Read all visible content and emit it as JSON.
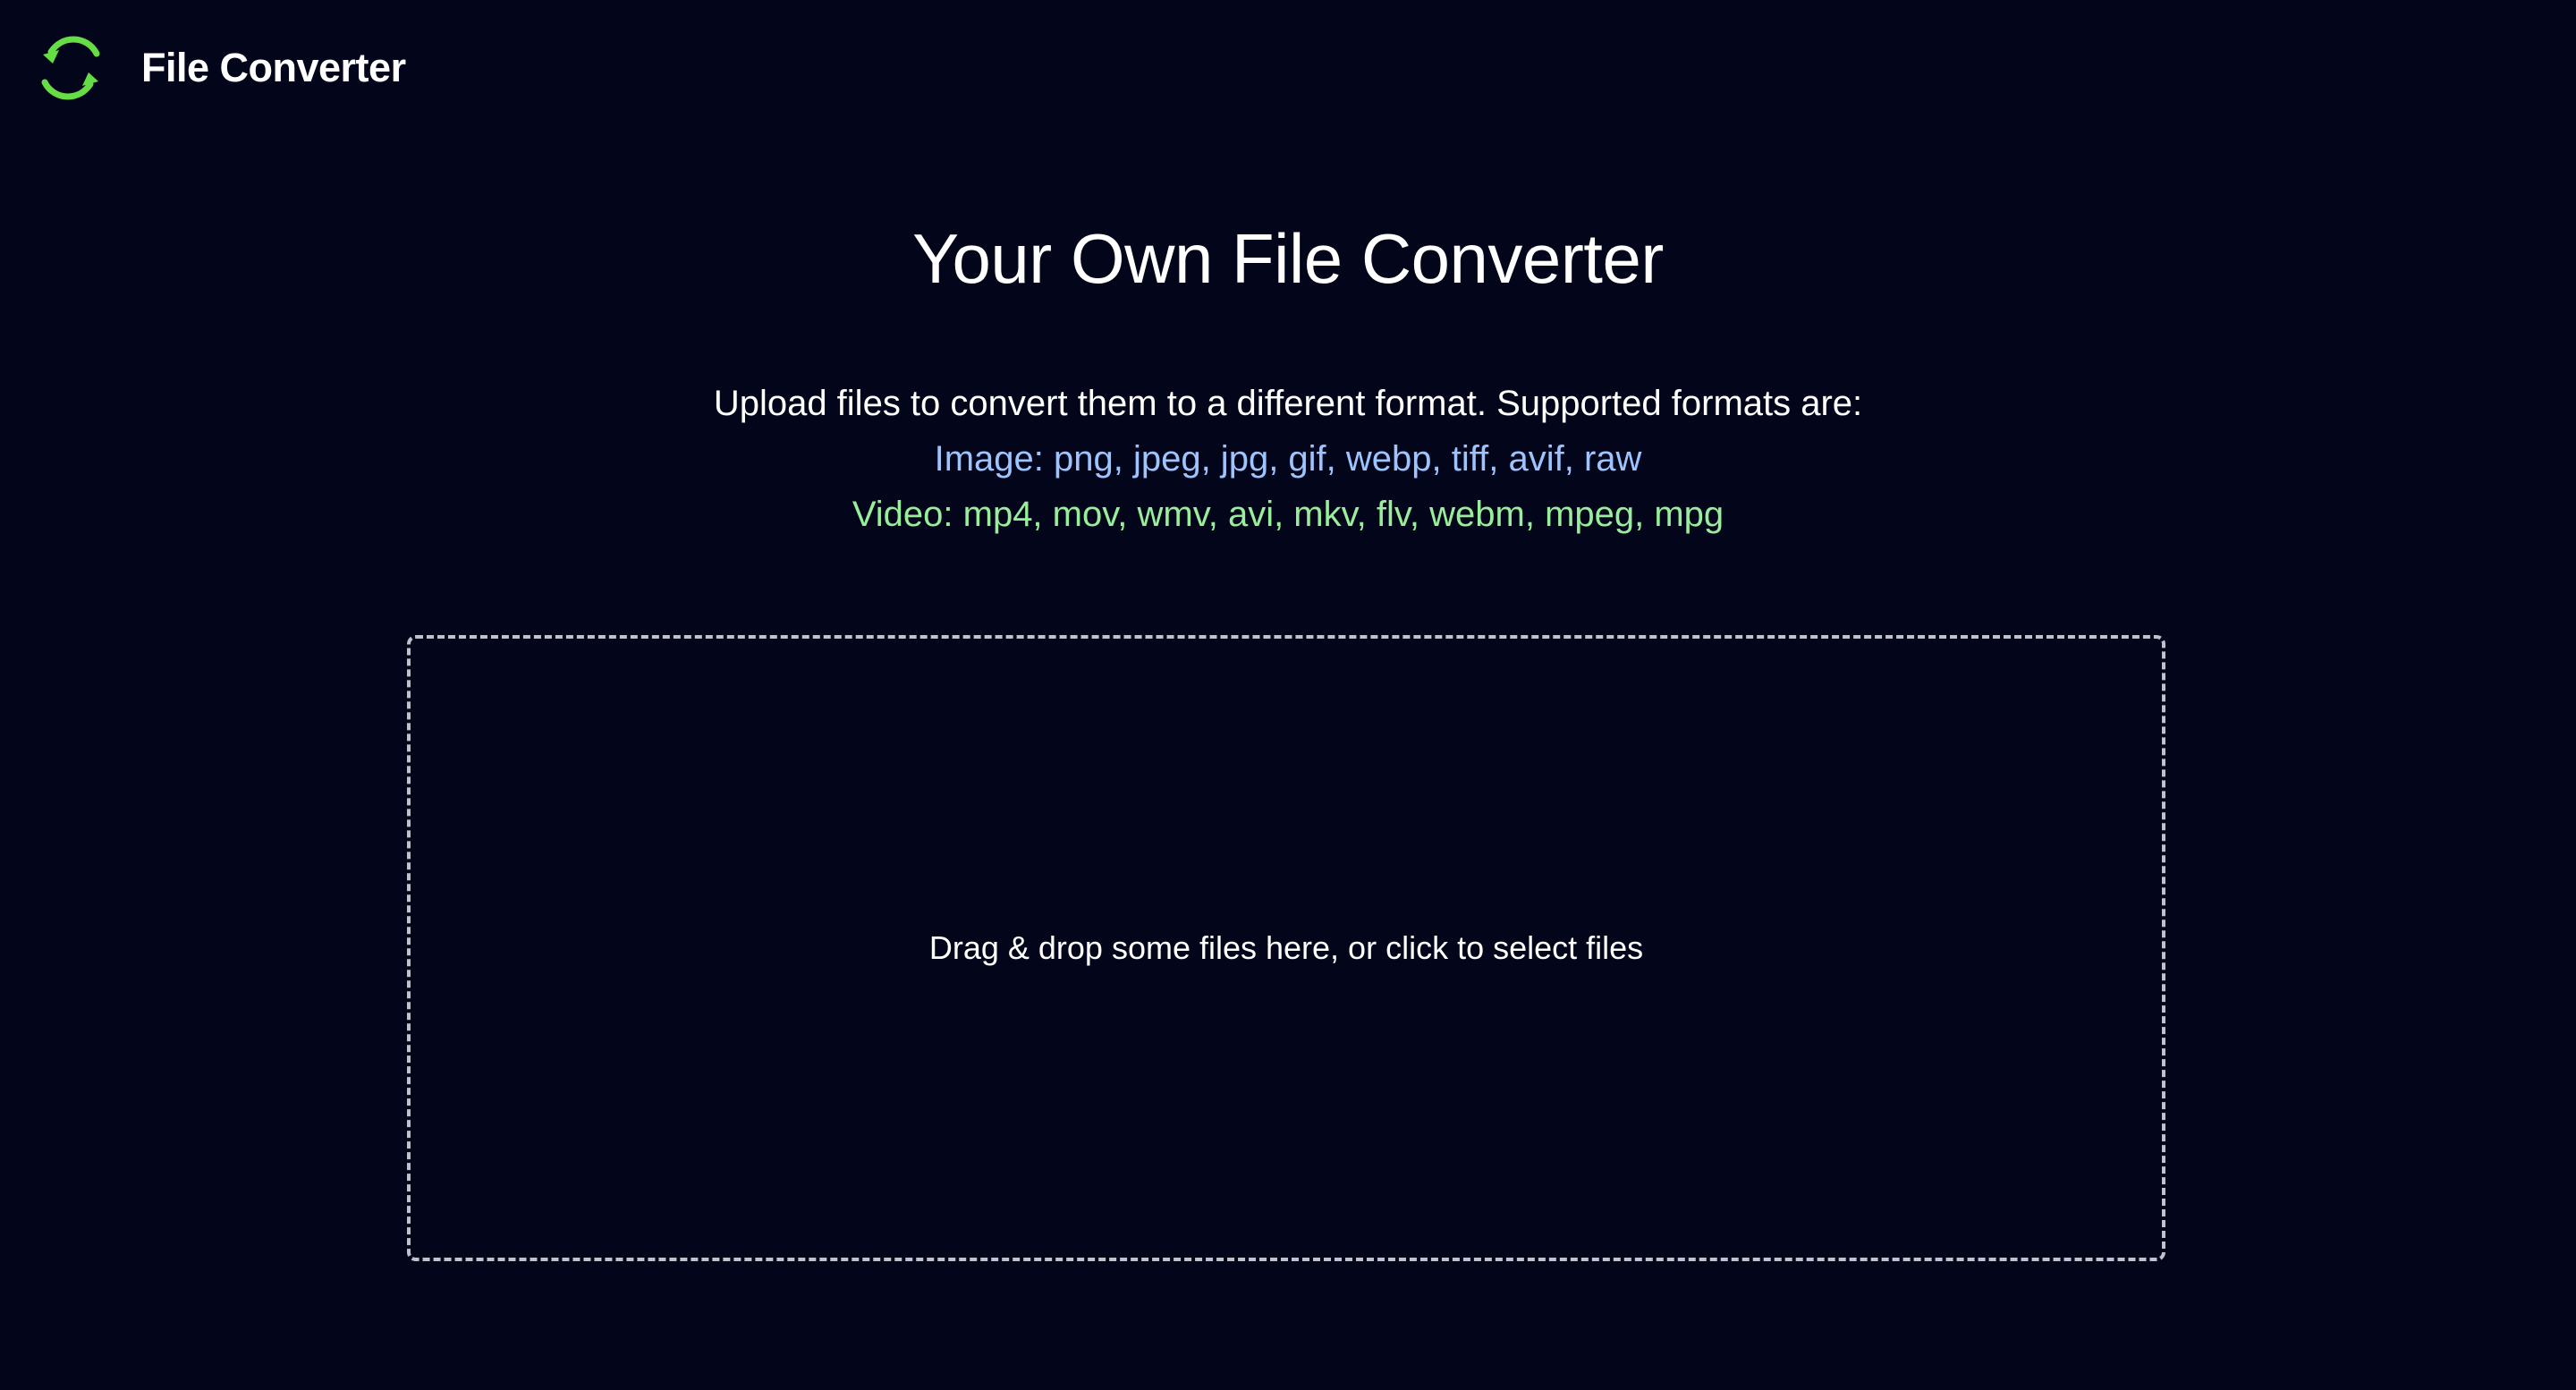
{
  "app": {
    "brand": "File Converter",
    "logo_icon": "refresh-arrows-icon",
    "accent": "#66dd44"
  },
  "page": {
    "title": "Your Own File Converter",
    "intro": "Upload files to convert them to a different format. Supported formats are:",
    "image_formats": "Image: png, jpeg, jpg, gif, webp, tiff, avif, raw",
    "video_formats": "Video: mp4, mov, wmv, avi, mkv, flv, webm, mpeg, mpg"
  },
  "dropzone": {
    "label": "Drag & drop some files here, or click to select files"
  },
  "colors": {
    "background": "#03061a",
    "image_formats": "#9ec4ff",
    "video_formats": "#98ee9b",
    "dropzone_border": "#bfc4cc"
  }
}
